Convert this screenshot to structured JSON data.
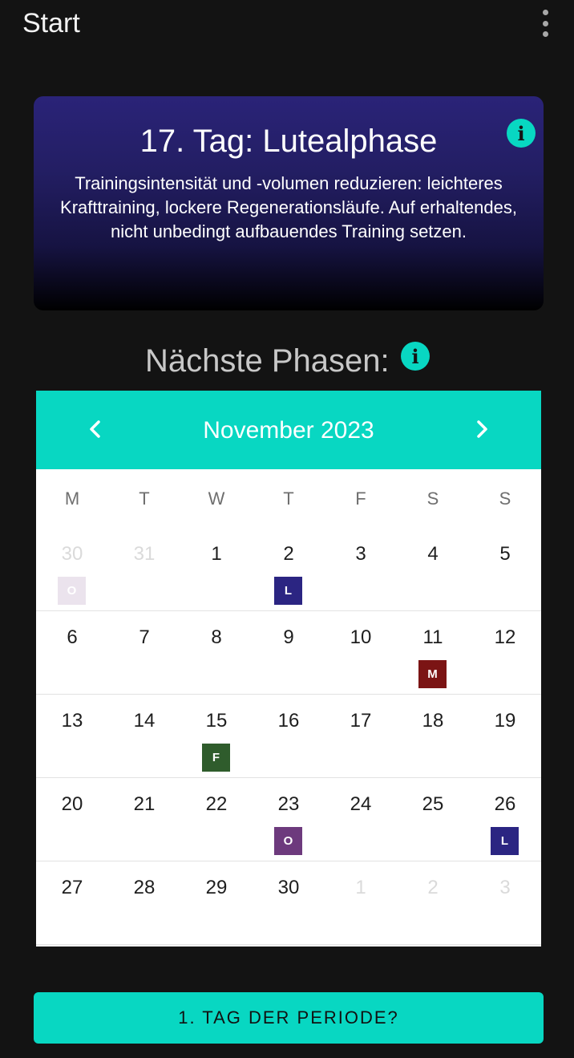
{
  "appbar": {
    "title": "Start",
    "menu_icon": "more-vert-icon"
  },
  "phase_card": {
    "heading": "17. Tag: Lutealphase",
    "description": "Trainingsintensität und -volumen reduzieren: leichteres Krafttraining, lockere Regenerationsläufe. Auf erhaltendes, nicht unbedingt aufbauendes Training setzen.",
    "info_icon_glyph": "i"
  },
  "next_phases": {
    "title": "Nächste Phasen:",
    "info_icon_glyph": "i"
  },
  "calendar": {
    "month_label": "November  2023",
    "prev_glyph": "‹",
    "next_glyph": "›",
    "weekdays": [
      "M",
      "T",
      "W",
      "T",
      "F",
      "S",
      "S"
    ],
    "weeks": [
      [
        {
          "day": "30",
          "other": true,
          "badge": "O",
          "badge_color": "#ebe3ed"
        },
        {
          "day": "31",
          "other": true
        },
        {
          "day": "1"
        },
        {
          "day": "2",
          "badge": "L",
          "badge_color": "#2b2582"
        },
        {
          "day": "3"
        },
        {
          "day": "4"
        },
        {
          "day": "5"
        }
      ],
      [
        {
          "day": "6"
        },
        {
          "day": "7"
        },
        {
          "day": "8"
        },
        {
          "day": "9"
        },
        {
          "day": "10"
        },
        {
          "day": "11",
          "badge": "M",
          "badge_color": "#7b1414"
        },
        {
          "day": "12"
        }
      ],
      [
        {
          "day": "13"
        },
        {
          "day": "14"
        },
        {
          "day": "15",
          "badge": "F",
          "badge_color": "#2f5c2c"
        },
        {
          "day": "16"
        },
        {
          "day": "17"
        },
        {
          "day": "18"
        },
        {
          "day": "19"
        }
      ],
      [
        {
          "day": "20"
        },
        {
          "day": "21"
        },
        {
          "day": "22"
        },
        {
          "day": "23",
          "badge": "O",
          "badge_color": "#6d3a7d"
        },
        {
          "day": "24"
        },
        {
          "day": "25"
        },
        {
          "day": "26",
          "badge": "L",
          "badge_color": "#2b2582"
        }
      ],
      [
        {
          "day": "27"
        },
        {
          "day": "28"
        },
        {
          "day": "29"
        },
        {
          "day": "30"
        },
        {
          "day": "1",
          "other": true
        },
        {
          "day": "2",
          "other": true
        },
        {
          "day": "3",
          "other": true
        }
      ]
    ]
  },
  "actions": {
    "period_button": "1. TAG DER PERIODE?"
  },
  "colors": {
    "accent": "#08d7c2",
    "background": "#131313",
    "card_top": "#2a2378"
  }
}
